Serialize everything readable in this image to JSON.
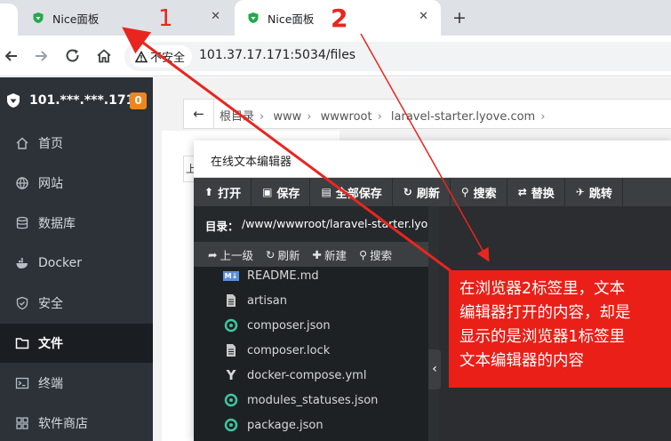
{
  "browser": {
    "tabs": [
      {
        "title": "Nice面板",
        "close": "✕"
      },
      {
        "title": "Nice面板",
        "close": "✕"
      }
    ],
    "new_tab": "+",
    "security_label": "不安全",
    "url": "101.37.17.171:5034/files"
  },
  "sidebar": {
    "server_ip": "101.***.***.171",
    "badge": "0",
    "items": [
      {
        "label": "首页",
        "icon": "home-icon"
      },
      {
        "label": "网站",
        "icon": "globe-icon"
      },
      {
        "label": "数据库",
        "icon": "database-icon"
      },
      {
        "label": "Docker",
        "icon": "docker-icon"
      },
      {
        "label": "安全",
        "icon": "shield-icon"
      },
      {
        "label": "文件",
        "icon": "folder-icon",
        "active": true
      },
      {
        "label": "终端",
        "icon": "terminal-icon"
      },
      {
        "label": "软件商店",
        "icon": "store-icon"
      }
    ]
  },
  "breadcrumb": {
    "back": "←",
    "parts": [
      "根目录",
      "www",
      "wwwroot",
      "laravel-starter.lyove.com"
    ]
  },
  "left_tool": "上",
  "editor": {
    "title": "在线文本编辑器",
    "toolbar": [
      {
        "label": "打开",
        "icon": "upload-icon"
      },
      {
        "label": "保存",
        "icon": "save-icon"
      },
      {
        "label": "全部保存",
        "icon": "save-all-icon"
      },
      {
        "label": "刷新",
        "icon": "refresh-icon"
      },
      {
        "label": "搜索",
        "icon": "search-icon"
      },
      {
        "label": "替换",
        "icon": "replace-icon"
      },
      {
        "label": "跳转",
        "icon": "jump-icon"
      }
    ],
    "dir_label": "目录：",
    "dir_path": "/www/wwwroot/laravel-starter.lyo",
    "sub_tools": [
      {
        "label": "上一级",
        "icon": "up-icon"
      },
      {
        "label": "刷新",
        "icon": "refresh-icon"
      },
      {
        "label": "新建",
        "icon": "plus-icon"
      },
      {
        "label": "搜索",
        "icon": "search-icon"
      }
    ],
    "files": [
      {
        "name": "README.md",
        "icon": "markdown-icon"
      },
      {
        "name": "artisan",
        "icon": "file-icon"
      },
      {
        "name": "composer.json",
        "icon": "json-icon"
      },
      {
        "name": "composer.lock",
        "icon": "file-icon"
      },
      {
        "name": "docker-compose.yml",
        "icon": "yaml-icon"
      },
      {
        "name": "modules_statuses.json",
        "icon": "json-icon"
      },
      {
        "name": "package.json",
        "icon": "json-icon"
      }
    ],
    "collapse": "‹"
  },
  "annotations": {
    "label_1": "1",
    "label_2": "2",
    "note_lines": [
      "在浏览器2标签里，文本",
      "编辑器打开的内容，却是",
      "显示的是浏览器1标签里",
      "文本编辑器的内容"
    ]
  },
  "colors": {
    "annotation_red": "#e8261f",
    "badge_orange": "#f0851e",
    "sidebar_bg": "#2c3238",
    "json_icon": "#3ec6a0"
  }
}
